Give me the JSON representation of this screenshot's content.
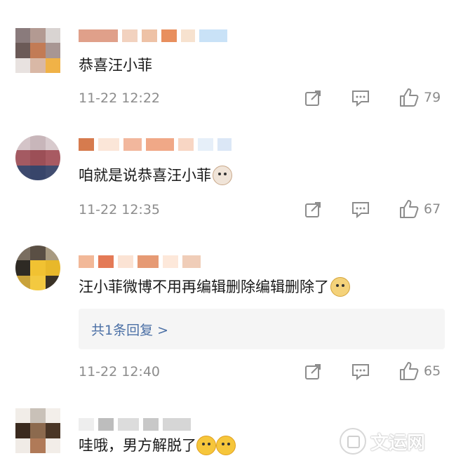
{
  "comments": [
    {
      "text": "恭喜汪小菲",
      "emoji": "",
      "time": "11-22 12:22",
      "likes": "79",
      "reply": ""
    },
    {
      "text": "咱就是说恭喜汪小菲",
      "emoji": "cat-emoji",
      "time": "11-22 12:35",
      "likes": "67",
      "reply": ""
    },
    {
      "text": "汪小菲微博不用再编辑删除编辑删除了",
      "emoji": "dog-emoji",
      "time": "11-22 12:40",
      "likes": "65",
      "reply": "共1条回复 >"
    },
    {
      "text": "哇哦，男方解脱了",
      "emoji": "cry-emoji x2",
      "time": "",
      "likes": "",
      "reply": ""
    }
  ],
  "watermark": {
    "text": "文运网"
  },
  "colors": {
    "meta": "#8c8c8c",
    "reply_link": "#4a6fa5",
    "reply_bg": "#f5f5f5"
  },
  "icons": [
    "share-icon",
    "comment-icon",
    "like-icon",
    "chevron-right-icon"
  ]
}
